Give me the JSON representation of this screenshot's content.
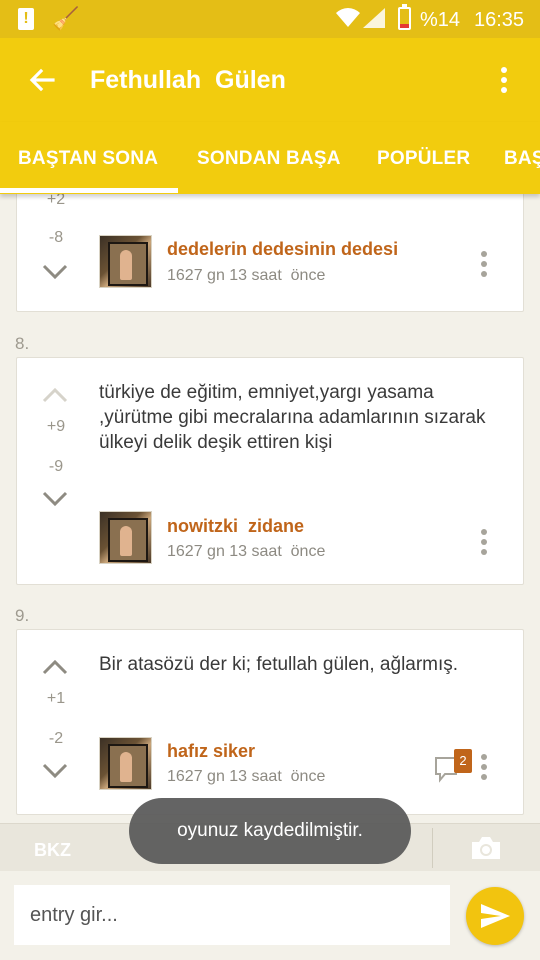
{
  "status_bar": {
    "battery_text": "%14",
    "time": "16:35"
  },
  "app_bar": {
    "title": "Fethullah  Gülen"
  },
  "tabs": [
    {
      "label": "BAŞTAN SONA",
      "active": true
    },
    {
      "label": "SONDAN BAŞA",
      "active": false
    },
    {
      "label": "POPÜLER",
      "active": false
    },
    {
      "label": "BAŞ",
      "active": false
    }
  ],
  "entries": [
    {
      "number": "",
      "upvotes": "+2",
      "downvotes": "-8",
      "text": "",
      "author": "dedelerin dedesinin dedesi",
      "meta": "1627 gn 13 saat  önce"
    },
    {
      "number": "8.",
      "upvotes": "+9",
      "downvotes": "-9",
      "text": "türkiye de eğitim, emniyet,yargı yasama ,yürütme gibi mecralarına adamlarının sızarak ülkeyi delik deşik ettiren kişi",
      "author": "nowitzki  zidane",
      "meta": "1627 gn 13 saat  önce"
    },
    {
      "number": "9.",
      "upvotes": "+1",
      "downvotes": "-2",
      "text": "Bir atasözü der ki; fetullah gülen, ağlarmış.",
      "author": "hafız siker",
      "meta": "1627 gn 13 saat  önce",
      "comment_count": "2"
    }
  ],
  "bottom_bar": {
    "bkz_label": "BKZ"
  },
  "input": {
    "placeholder": "entry gir..."
  },
  "toast": {
    "message": "oyunuz kaydedilmiştir."
  }
}
